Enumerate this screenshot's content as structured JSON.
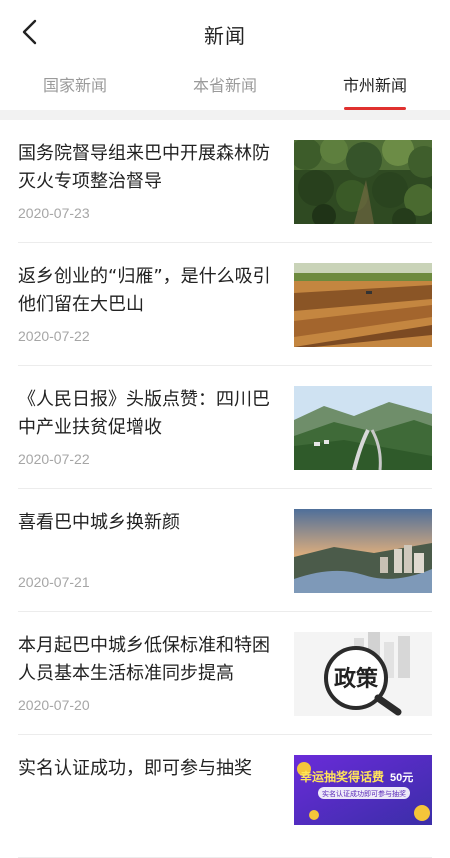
{
  "header": {
    "title": "新闻",
    "back_icon": "chevron-left-icon"
  },
  "tabs": [
    {
      "label": "国家新闻",
      "active": false
    },
    {
      "label": "本省新闻",
      "active": false
    },
    {
      "label": "市州新闻",
      "active": true
    }
  ],
  "colors": {
    "accent": "#e0312f",
    "muted_text": "#9a9a9a",
    "date_text": "#a6a6a6"
  },
  "news": [
    {
      "title": "国务院督导组来巴中开展森林防灭火专项整治督导",
      "date": "2020-07-23",
      "image": "forest-photo"
    },
    {
      "title": "返乡创业的“归雁”，是什么吸引他们留在大巴山",
      "date": "2020-07-22",
      "image": "farmland-photo"
    },
    {
      "title": "《人民日报》头版点赞：四川巴中产业扶贫促增收",
      "date": "2020-07-22",
      "image": "valley-road-photo"
    },
    {
      "title": "喜看巴中城乡换新颜",
      "date": "2020-07-21",
      "image": "city-river-photo"
    },
    {
      "title": "本月起巴中城乡低保标准和特困人员基本生活标准同步提高",
      "date": "2020-07-20",
      "image": "policy-magnifier-photo",
      "image_text": "政策"
    },
    {
      "title": "实名认证成功，即可参与抽奖",
      "date": "",
      "image": "lottery-banner",
      "image_text": "幸运抽奖得话费",
      "image_text2": "50元",
      "image_subtext": "实名认证成功即可参与抽奖"
    }
  ]
}
